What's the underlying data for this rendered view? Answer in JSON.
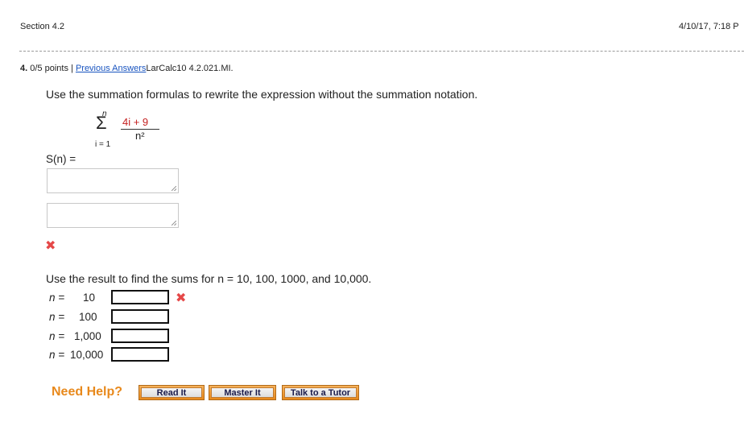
{
  "header": {
    "section": "Section 4.2",
    "datetime": "4/10/17, 7:18 P"
  },
  "question": {
    "number": "4.",
    "points": "0/5 points",
    "separator": "|",
    "previous_answers": "Previous Answers",
    "reference": "LarCalc10 4.2.021.MI.",
    "instruction": "Use the summation formulas to rewrite the expression without the summation notation.",
    "formula": {
      "upper": "n",
      "sigma": "Σ",
      "lower": "i = 1",
      "numerator": "4i + 9",
      "denominator": "n²"
    },
    "sn_label": "S(n) =",
    "second_instruction": "Use the result to find the sums for n = 10, 100, 1000, and 10,000.",
    "rows": [
      {
        "label": "n =",
        "value": "10"
      },
      {
        "label": "n =",
        "value": "100"
      },
      {
        "label": "n =",
        "value": "1,000"
      },
      {
        "label": "n =",
        "value": "10,000"
      }
    ],
    "incorrect_mark": "✖"
  },
  "help": {
    "label": "Need Help?",
    "buttons": [
      "Read It",
      "Master It",
      "Talk to a Tutor"
    ]
  },
  "colors": {
    "accent_orange": "#e8891c",
    "link_blue": "#1a55c0",
    "error_red": "#e54848"
  }
}
